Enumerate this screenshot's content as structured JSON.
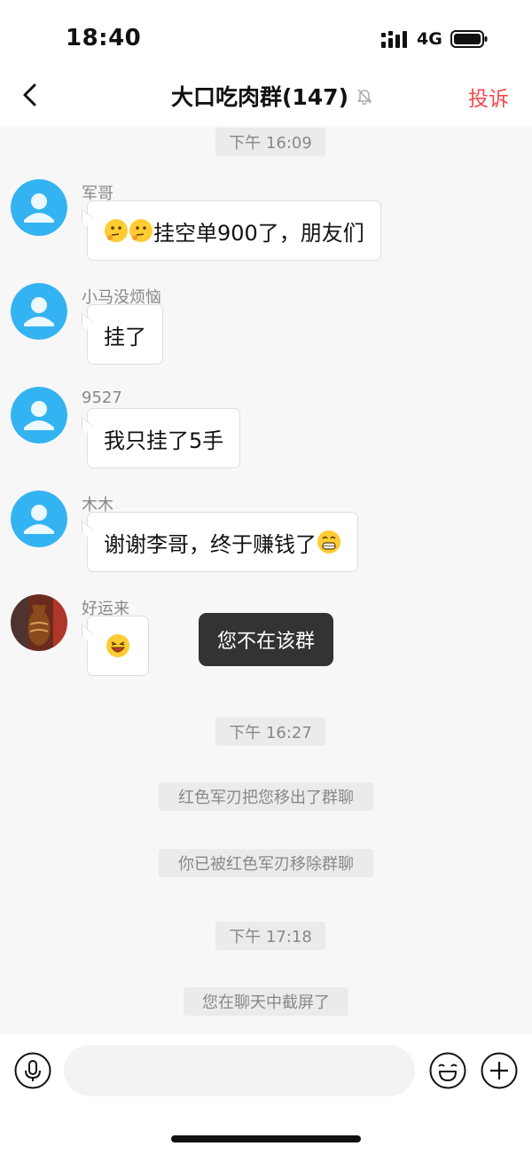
{
  "status_bar": {
    "time": "18:40",
    "network": "4G"
  },
  "header": {
    "title": "大口吃肉群(147)",
    "report_label": "投诉"
  },
  "timestamps": {
    "t1": "下午 16:09",
    "t2": "下午 16:27",
    "t3": "下午 17:18"
  },
  "messages": [
    {
      "sender": "军哥",
      "text": "挂空单900了，朋友们"
    },
    {
      "sender": "小马没烦恼",
      "text": "挂了"
    },
    {
      "sender": "9527",
      "text": "我只挂了5手"
    },
    {
      "sender": "木木",
      "text": "谢谢李哥，终于赚钱了"
    },
    {
      "sender": "好运来",
      "text": ""
    }
  ],
  "toast": "您不在该群",
  "system_messages": {
    "removed_by": "红色军刃把您移出了群聊",
    "removed": "你已被红色军刃移除群聊",
    "screenshot": "您在聊天中截屏了"
  },
  "input": {
    "placeholder": ""
  },
  "colors": {
    "accent_red": "#f2494d",
    "avatar_blue": "#34b3f2",
    "toast_bg": "#333333"
  }
}
